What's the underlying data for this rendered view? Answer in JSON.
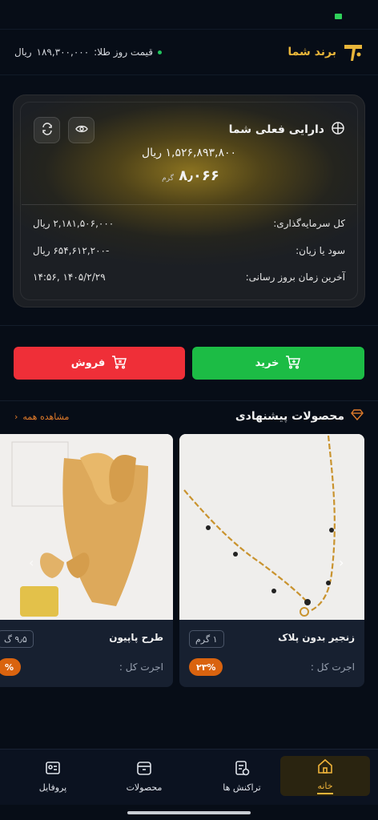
{
  "colors": {
    "background": "#070d17",
    "gold": "#e9b63a",
    "buy": "#1cbc45",
    "sell": "#ef2f38",
    "badge": "#d9630f",
    "see_all": "#e07b2a"
  },
  "header": {
    "brand_name": "برند شما",
    "gold_price_label": "قیمت روز طلا:",
    "gold_price_value": "۱۸۹,۳۰۰,۰۰۰",
    "gold_price_unit": "ریال"
  },
  "wallet": {
    "title": "دارایی فعلی شما",
    "value_amount": "۱,۵۲۶,۸۹۳,۸۰۰ ریال",
    "grams": "۸٫۰۶۶",
    "grams_unit": "گرم",
    "rows": [
      {
        "label": "کل سرمایه‌گذاری:",
        "value": "۲,۱۸۱,۵۰۶,۰۰۰ ریال"
      },
      {
        "label": "سود یا زیان:",
        "value": "-۶۵۴,۶۱۲,۲۰۰ ریال"
      },
      {
        "label": "آخرین زمان بروز رسانی:",
        "value": "۱۴۰۵/۲/۲۹ ,۱۴:۵۶"
      }
    ],
    "icons": [
      "eye-icon",
      "refresh-icon",
      "crosshair-icon"
    ]
  },
  "actions": {
    "buy_label": "خرید",
    "sell_label": "فروش"
  },
  "products": {
    "title": "محصولات پیشنهادی",
    "see_all_label": "مشاهده همه",
    "items": [
      {
        "name": "زنجیر بدون پلاک",
        "weight": "۱ گرم",
        "fee_label": "اجرت کل :",
        "badge": "۲۳%"
      },
      {
        "name": "طرح پاپیون",
        "weight": "۹٫۵ گ",
        "fee_label": "اجرت کل :",
        "badge": "%"
      }
    ]
  },
  "nav": {
    "items": [
      {
        "label": "خانه",
        "icon": "home-icon",
        "active": true
      },
      {
        "label": "تراکنش ها",
        "icon": "receipt-icon",
        "active": false
      },
      {
        "label": "محصولات",
        "icon": "box-icon",
        "active": false
      },
      {
        "label": "پروفایل",
        "icon": "profile-card-icon",
        "active": false
      }
    ]
  }
}
